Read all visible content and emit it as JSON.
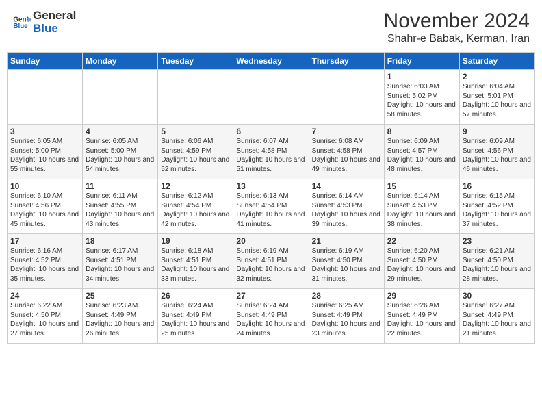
{
  "logo": {
    "text_general": "General",
    "text_blue": "Blue"
  },
  "title": "November 2024",
  "location": "Shahr-e Babak, Kerman, Iran",
  "weekdays": [
    "Sunday",
    "Monday",
    "Tuesday",
    "Wednesday",
    "Thursday",
    "Friday",
    "Saturday"
  ],
  "weeks": [
    [
      {
        "day": "",
        "info": ""
      },
      {
        "day": "",
        "info": ""
      },
      {
        "day": "",
        "info": ""
      },
      {
        "day": "",
        "info": ""
      },
      {
        "day": "",
        "info": ""
      },
      {
        "day": "1",
        "info": "Sunrise: 6:03 AM\nSunset: 5:02 PM\nDaylight: 10 hours and 58 minutes."
      },
      {
        "day": "2",
        "info": "Sunrise: 6:04 AM\nSunset: 5:01 PM\nDaylight: 10 hours and 57 minutes."
      }
    ],
    [
      {
        "day": "3",
        "info": "Sunrise: 6:05 AM\nSunset: 5:00 PM\nDaylight: 10 hours and 55 minutes."
      },
      {
        "day": "4",
        "info": "Sunrise: 6:05 AM\nSunset: 5:00 PM\nDaylight: 10 hours and 54 minutes."
      },
      {
        "day": "5",
        "info": "Sunrise: 6:06 AM\nSunset: 4:59 PM\nDaylight: 10 hours and 52 minutes."
      },
      {
        "day": "6",
        "info": "Sunrise: 6:07 AM\nSunset: 4:58 PM\nDaylight: 10 hours and 51 minutes."
      },
      {
        "day": "7",
        "info": "Sunrise: 6:08 AM\nSunset: 4:58 PM\nDaylight: 10 hours and 49 minutes."
      },
      {
        "day": "8",
        "info": "Sunrise: 6:09 AM\nSunset: 4:57 PM\nDaylight: 10 hours and 48 minutes."
      },
      {
        "day": "9",
        "info": "Sunrise: 6:09 AM\nSunset: 4:56 PM\nDaylight: 10 hours and 46 minutes."
      }
    ],
    [
      {
        "day": "10",
        "info": "Sunrise: 6:10 AM\nSunset: 4:56 PM\nDaylight: 10 hours and 45 minutes."
      },
      {
        "day": "11",
        "info": "Sunrise: 6:11 AM\nSunset: 4:55 PM\nDaylight: 10 hours and 43 minutes."
      },
      {
        "day": "12",
        "info": "Sunrise: 6:12 AM\nSunset: 4:54 PM\nDaylight: 10 hours and 42 minutes."
      },
      {
        "day": "13",
        "info": "Sunrise: 6:13 AM\nSunset: 4:54 PM\nDaylight: 10 hours and 41 minutes."
      },
      {
        "day": "14",
        "info": "Sunrise: 6:14 AM\nSunset: 4:53 PM\nDaylight: 10 hours and 39 minutes."
      },
      {
        "day": "15",
        "info": "Sunrise: 6:14 AM\nSunset: 4:53 PM\nDaylight: 10 hours and 38 minutes."
      },
      {
        "day": "16",
        "info": "Sunrise: 6:15 AM\nSunset: 4:52 PM\nDaylight: 10 hours and 37 minutes."
      }
    ],
    [
      {
        "day": "17",
        "info": "Sunrise: 6:16 AM\nSunset: 4:52 PM\nDaylight: 10 hours and 35 minutes."
      },
      {
        "day": "18",
        "info": "Sunrise: 6:17 AM\nSunset: 4:51 PM\nDaylight: 10 hours and 34 minutes."
      },
      {
        "day": "19",
        "info": "Sunrise: 6:18 AM\nSunset: 4:51 PM\nDaylight: 10 hours and 33 minutes."
      },
      {
        "day": "20",
        "info": "Sunrise: 6:19 AM\nSunset: 4:51 PM\nDaylight: 10 hours and 32 minutes."
      },
      {
        "day": "21",
        "info": "Sunrise: 6:19 AM\nSunset: 4:50 PM\nDaylight: 10 hours and 31 minutes."
      },
      {
        "day": "22",
        "info": "Sunrise: 6:20 AM\nSunset: 4:50 PM\nDaylight: 10 hours and 29 minutes."
      },
      {
        "day": "23",
        "info": "Sunrise: 6:21 AM\nSunset: 4:50 PM\nDaylight: 10 hours and 28 minutes."
      }
    ],
    [
      {
        "day": "24",
        "info": "Sunrise: 6:22 AM\nSunset: 4:50 PM\nDaylight: 10 hours and 27 minutes."
      },
      {
        "day": "25",
        "info": "Sunrise: 6:23 AM\nSunset: 4:49 PM\nDaylight: 10 hours and 26 minutes."
      },
      {
        "day": "26",
        "info": "Sunrise: 6:24 AM\nSunset: 4:49 PM\nDaylight: 10 hours and 25 minutes."
      },
      {
        "day": "27",
        "info": "Sunrise: 6:24 AM\nSunset: 4:49 PM\nDaylight: 10 hours and 24 minutes."
      },
      {
        "day": "28",
        "info": "Sunrise: 6:25 AM\nSunset: 4:49 PM\nDaylight: 10 hours and 23 minutes."
      },
      {
        "day": "29",
        "info": "Sunrise: 6:26 AM\nSunset: 4:49 PM\nDaylight: 10 hours and 22 minutes."
      },
      {
        "day": "30",
        "info": "Sunrise: 6:27 AM\nSunset: 4:49 PM\nDaylight: 10 hours and 21 minutes."
      }
    ]
  ]
}
